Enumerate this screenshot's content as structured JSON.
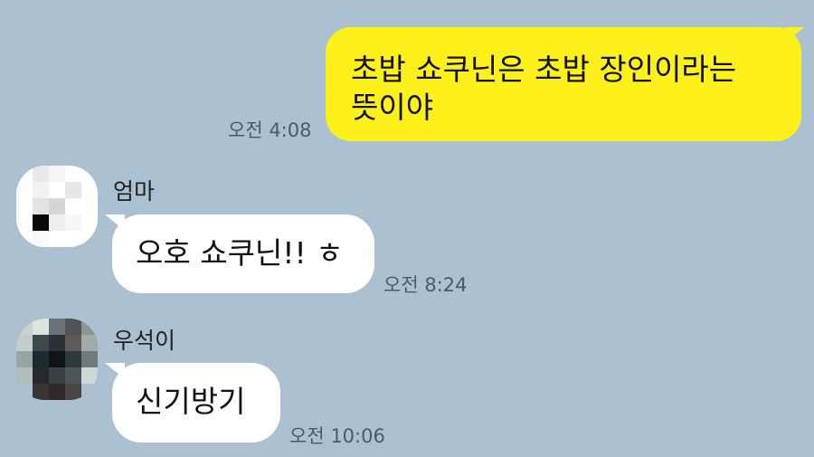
{
  "messages": [
    {
      "side": "me",
      "text_line1": "초밥 쇼쿠닌은 초밥 장인이라는",
      "text_line2": "뜻이야",
      "time": "오전 4:08"
    },
    {
      "side": "other",
      "sender": "엄마",
      "text": "오호 쇼쿠닌!! ㅎ",
      "time": "오전 8:24"
    },
    {
      "side": "other",
      "sender": "우석이",
      "text": "신기방기",
      "time": "오전 10:06"
    }
  ],
  "colors": {
    "background": "#abc1d1",
    "my_bubble": "#fef01b",
    "other_bubble": "#ffffff",
    "timestamp": "#4b5a66"
  },
  "icons": {
    "avatar_1": "pixelated-profile-photo",
    "avatar_2": "pixelated-profile-photo"
  }
}
